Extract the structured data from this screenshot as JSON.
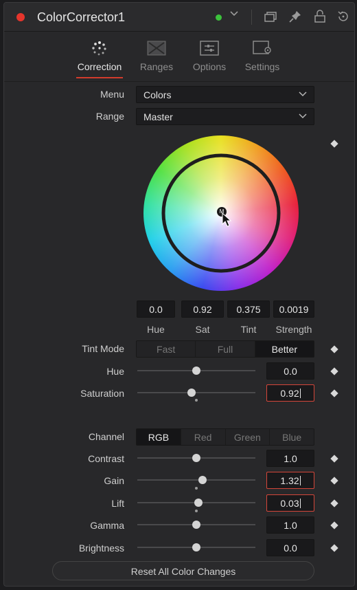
{
  "header": {
    "title": "ColorCorrector1"
  },
  "tabs": [
    {
      "label": "Correction",
      "active": true,
      "icon": "correction-icon"
    },
    {
      "label": "Ranges",
      "active": false,
      "icon": "ranges-icon"
    },
    {
      "label": "Options",
      "active": false,
      "icon": "options-icon"
    },
    {
      "label": "Settings",
      "active": false,
      "icon": "settings-icon"
    }
  ],
  "menu": {
    "label": "Menu",
    "value": "Colors"
  },
  "range": {
    "label": "Range",
    "value": "Master"
  },
  "wheel": {
    "marker": "M",
    "values": [
      "0.0",
      "0.92",
      "0.375",
      "0.0019"
    ],
    "labels": [
      "Hue",
      "Sat",
      "Tint",
      "Strength"
    ]
  },
  "tint_mode": {
    "label": "Tint Mode",
    "options": [
      "Fast",
      "Full",
      "Better"
    ],
    "selected": "Better"
  },
  "hue": {
    "label": "Hue",
    "value": "0.0",
    "level": 0.5
  },
  "saturation": {
    "label": "Saturation",
    "value": "0.92",
    "level": 0.46
  },
  "channel": {
    "label": "Channel",
    "options": [
      "RGB",
      "Red",
      "Green",
      "Blue"
    ],
    "selected": "RGB"
  },
  "contrast": {
    "label": "Contrast",
    "value": "1.0",
    "level": 0.5
  },
  "gain": {
    "label": "Gain",
    "value": "1.32",
    "level": 0.55
  },
  "lift": {
    "label": "Lift",
    "value": "0.03",
    "level": 0.52
  },
  "gamma": {
    "label": "Gamma",
    "value": "1.0",
    "level": 0.5
  },
  "brightness": {
    "label": "Brightness",
    "value": "0.0",
    "level": 0.5
  },
  "reset": {
    "label": "Reset All Color Changes"
  },
  "colors": {
    "accent": "#d23b2c",
    "tool_dot": "#e5352c",
    "status": "#3cc23c"
  }
}
